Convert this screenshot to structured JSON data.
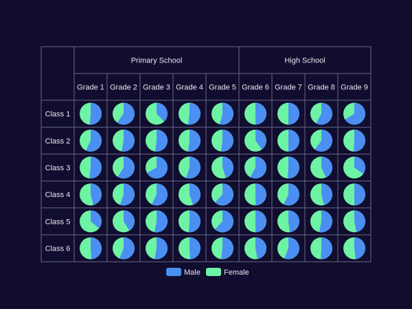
{
  "chart_data": {
    "type": "pie",
    "title": "",
    "groups": [
      {
        "label": "Primary School",
        "span": 5
      },
      {
        "label": "High School",
        "span": 4
      }
    ],
    "columns": [
      "Grade 1",
      "Grade 2",
      "Grade 3",
      "Grade 4",
      "Grade 5",
      "Grade 6",
      "Grade 7",
      "Grade 8",
      "Grade 9"
    ],
    "rows": [
      "Class 1",
      "Class 2",
      "Class 3",
      "Class 4",
      "Class 5",
      "Class 6"
    ],
    "series": [
      {
        "name": "Male",
        "color": "#4b8ff3"
      },
      {
        "name": "Female",
        "color": "#6ef3a5"
      }
    ],
    "male_share": [
      [
        0.51,
        0.6,
        0.38,
        0.52,
        0.54,
        0.5,
        0.5,
        0.58,
        0.66
      ],
      [
        0.57,
        0.53,
        0.52,
        0.52,
        0.52,
        0.4,
        0.5,
        0.6,
        0.51
      ],
      [
        0.52,
        0.59,
        0.67,
        0.55,
        0.45,
        0.58,
        0.51,
        0.43,
        0.35
      ],
      [
        0.46,
        0.55,
        0.57,
        0.45,
        0.62,
        0.5,
        0.57,
        0.46,
        0.5
      ],
      [
        0.36,
        0.41,
        0.53,
        0.51,
        0.62,
        0.5,
        0.48,
        0.53,
        0.47
      ],
      [
        0.49,
        0.56,
        0.53,
        0.49,
        0.52,
        0.47,
        0.56,
        0.51,
        0.48
      ]
    ],
    "legend": "bottom"
  }
}
